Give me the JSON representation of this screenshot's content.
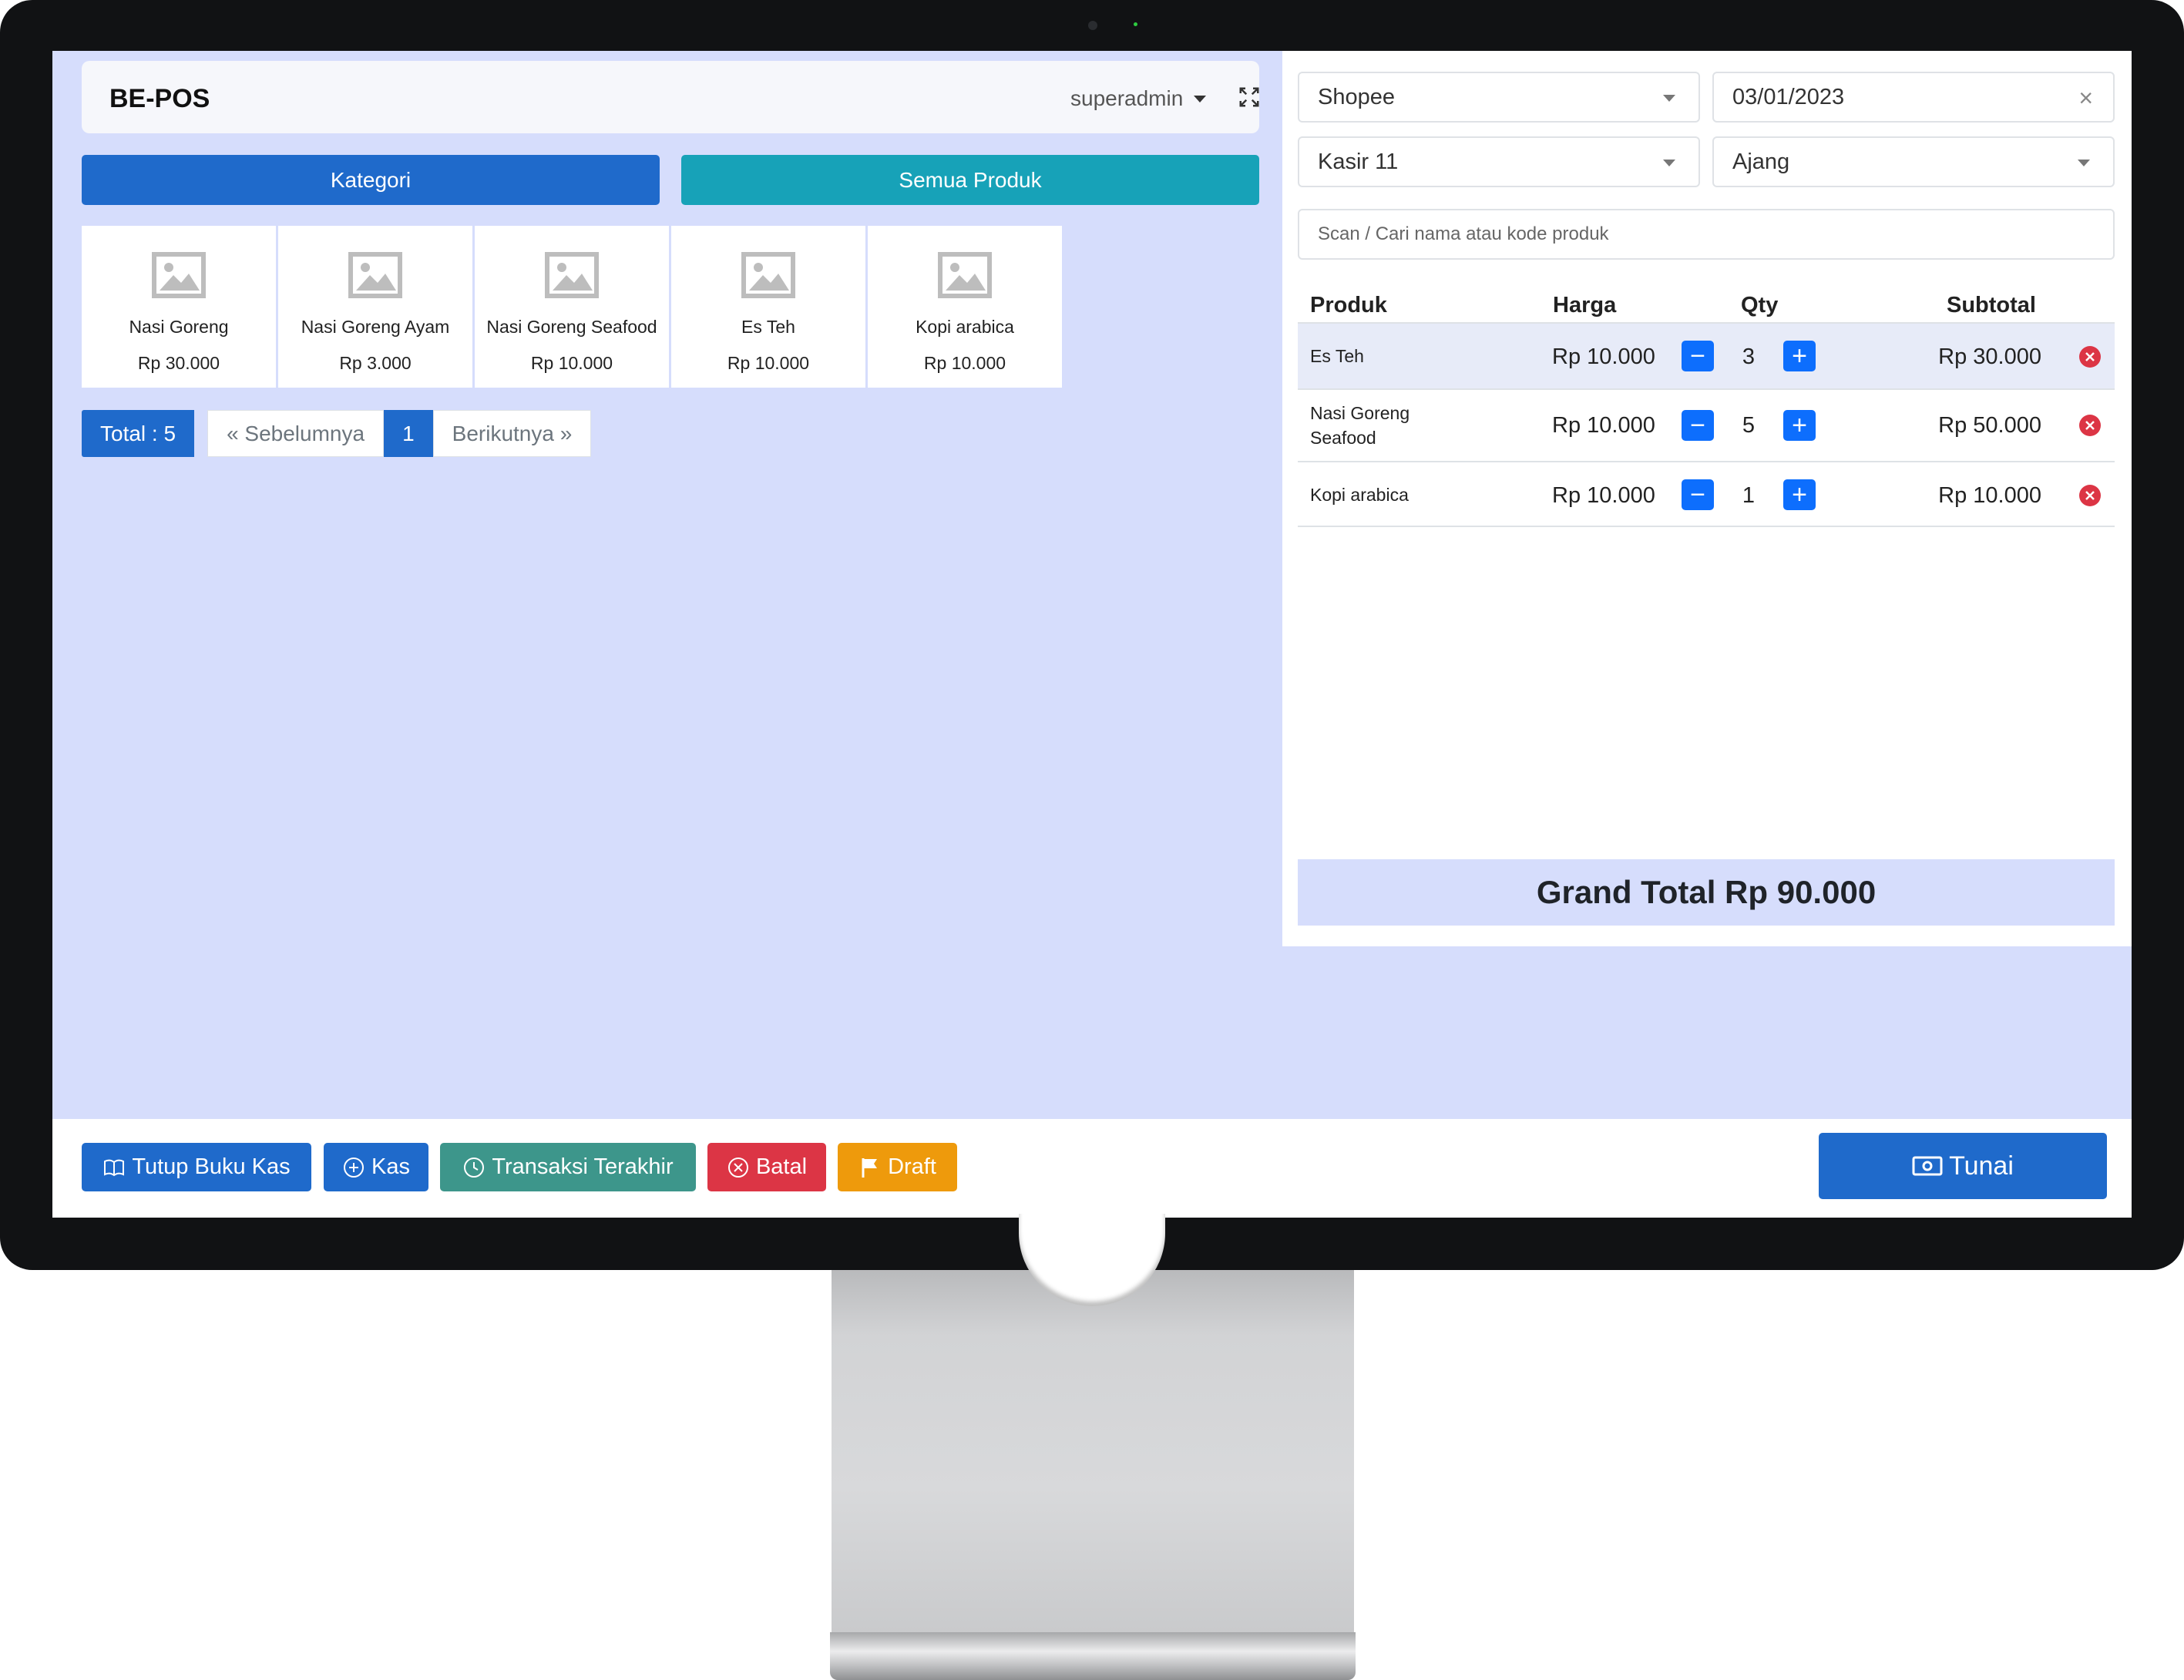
{
  "header": {
    "brand": "BE-POS",
    "user": "superadmin"
  },
  "tabs": {
    "kategori": "Kategori",
    "semua": "Semua Produk"
  },
  "products": [
    {
      "name": "Nasi Goreng",
      "price": "Rp 30.000"
    },
    {
      "name": "Nasi Goreng Ayam",
      "price": "Rp 3.000"
    },
    {
      "name": "Nasi Goreng Seafood",
      "price": "Rp 10.000"
    },
    {
      "name": "Es Teh",
      "price": "Rp 10.000"
    },
    {
      "name": "Kopi arabica",
      "price": "Rp 10.000"
    }
  ],
  "pagination": {
    "total": "Total : 5",
    "prev": "« Sebelumnya",
    "current": "1",
    "next": "Berikutnya »"
  },
  "order": {
    "channel": "Shopee",
    "date": "03/01/2023",
    "cashier": "Kasir 11",
    "staff": "Ajang",
    "search_placeholder": "Scan / Cari nama atau kode produk"
  },
  "cart": {
    "headers": {
      "product": "Produk",
      "price": "Harga",
      "qty": "Qty",
      "subtotal": "Subtotal"
    },
    "rows": [
      {
        "name": "Es Teh",
        "price": "Rp 10.000",
        "qty": "3",
        "subtotal": "Rp 30.000"
      },
      {
        "name": "Nasi Goreng Seafood",
        "price": "Rp 10.000",
        "qty": "5",
        "subtotal": "Rp 50.000"
      },
      {
        "name": "Kopi arabica",
        "price": "Rp 10.000",
        "qty": "1",
        "subtotal": "Rp 10.000"
      }
    ],
    "grand_total": "Grand Total Rp 90.000"
  },
  "footer": {
    "tutup_buku": "Tutup Buku Kas",
    "kas": "Kas",
    "transaksi": "Transaksi Terakhir",
    "batal": "Batal",
    "draft": "Draft",
    "tunai": "Tunai"
  },
  "colors": {
    "primary": "#1f6acb",
    "info": "#17a2b8",
    "teal": "#3d968b",
    "danger": "#dc3545",
    "warning": "#ee9a0c",
    "background": "#d6ddfc"
  }
}
